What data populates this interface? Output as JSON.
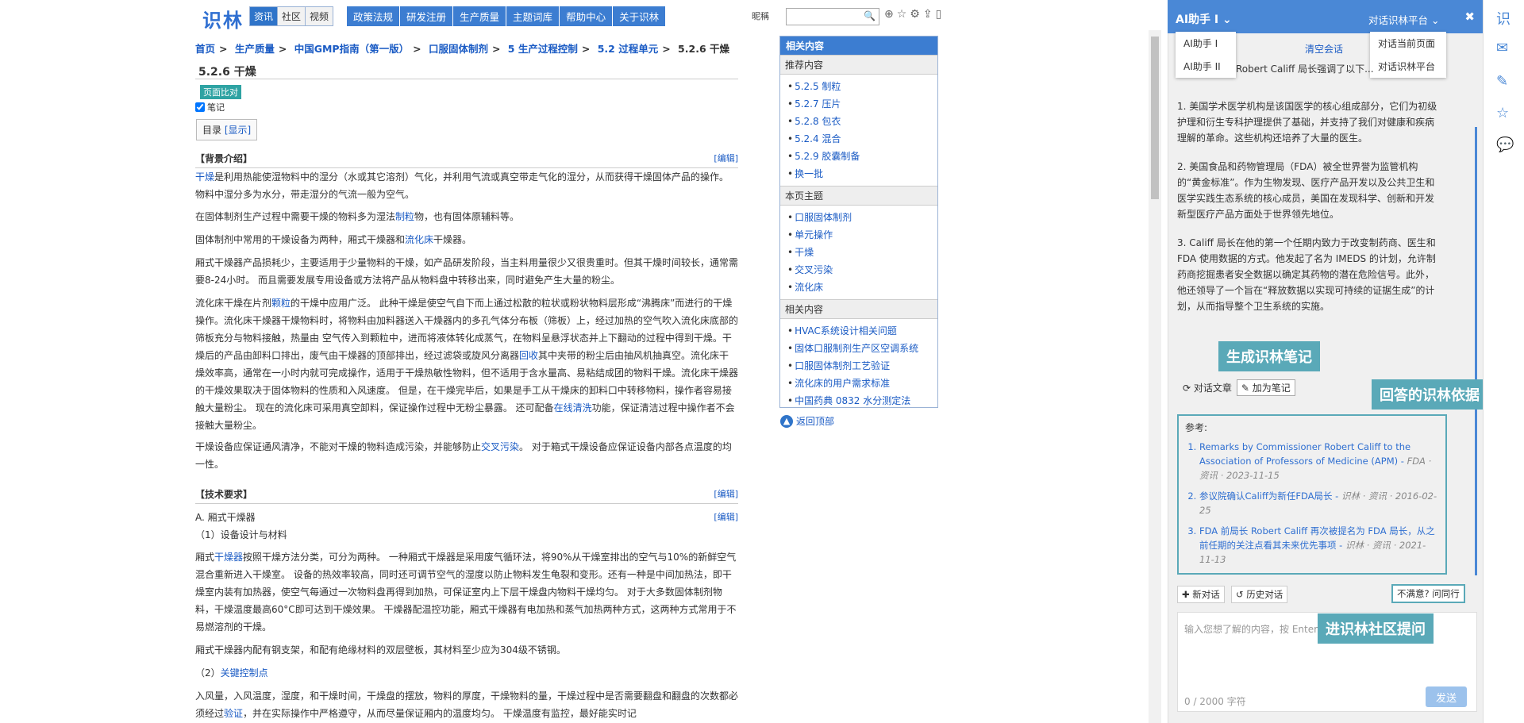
{
  "site": {
    "logo": "识林",
    "tabs": [
      {
        "label": "资讯",
        "active": true
      },
      {
        "label": "社区",
        "active": false
      },
      {
        "label": "视频",
        "active": false
      }
    ],
    "menu": [
      "政策法规",
      "研发注册",
      "生产质量",
      "主题词库",
      "帮助中心",
      "关于识林"
    ],
    "search_label": "昵稱",
    "search_placeholder": ""
  },
  "breadcrumb": [
    "首页",
    "生产质量",
    "中国GMP指南（第一版）",
    "口服固体制剂",
    "5 生产过程控制",
    "5.2 过程单元",
    "5.2.6 干燥"
  ],
  "page": {
    "title": "5.2.6 干燥",
    "compare_label": "页面比对",
    "note_label": "笔记",
    "toc_label": "目录",
    "toc_show": "[显示]",
    "edit_label": "[编辑]"
  },
  "sections": {
    "background": "【背景介绍】",
    "tech": "【技术要求】",
    "sub_a": "A. 厢式干燥器",
    "sub_a1": "（1）设备设计与材料",
    "sub_a2_num": "（2）",
    "sub_a2_link": "关键控制点"
  },
  "paragraphs": {
    "p1_link": "干燥",
    "p1": "是利用热能使湿物料中的湿分（水或其它溶剂）气化，并利用气流或真空带走气化的湿分，从而获得干燥固体产品的操作。物料中湿分多为水分，带走湿分的气流一般为空气。",
    "p2a": "在固体制剂生产过程中需要干燥的物料多为湿法",
    "p2_link": "制粒",
    "p2b": "物，也有固体原辅料等。",
    "p3a": "固体制剂中常用的干燥设备为两种，厢式干燥器和",
    "p3_link": "流化床",
    "p3b": "干燥器。",
    "p4": "厢式干燥器产品损耗少，主要适用于少量物料的干燥，如产品研发阶段，当主料用量很少又很贵重时。但其干燥时间较长，通常需要8-24小时。 而且需要发展专用设备或方法将产品从物料盘中转移出来，同时避免产生大量的粉尘。",
    "p5a": "流化床干燥在片剂",
    "p5_link1": "颗粒",
    "p5b": "的干燥中应用广泛。 此种干燥是使空气自下而上通过松散的粒状或粉状物料层形成“沸腾床”而进行的干燥操作。流化床干燥器干燥物料时，将物料由加料器送入干燥器内的多孔气体分布板（筛板）上，经过加热的空气吹入流化床底部的筛板充分与物料接触，热量由 空气传入到颗粒中，进而将液体转化成蒸气，在物料呈悬浮状态并上下翻动的过程中得到干燥。干燥后的产品由卸料口排出，废气由干燥器的顶部排出，经过滤袋或旋风分离器",
    "p5_link2": "回收",
    "p5c": "其中夹带的粉尘后由抽风机抽真空。流化床干燥效率高，通常在一小时内就可完成操作，适用于干燥热敏性物料，但不适用于含水量高、易粘结成团的物料干燥。流化床干燥器的干燥效果取决于固体物料的性质和入风速度。 但是，在干燥完毕后，如果是手工从干燥床的卸料口中转移物料，操作者容易接触大量粉尘。 现在的流化床可采用真空卸料，保证操作过程中无粉尘暴露。 还可配备",
    "p5_link3": "在线清洗",
    "p5d": "功能，保证清洁过程中操作者不会接触大量粉尘。",
    "p6a": "干燥设备应保证通风清净，不能对干燥的物料造成污染，并能够防止",
    "p6_link": "交叉污染",
    "p6b": "。 对于箱式干燥设备应保证设备内部各点温度的均一性。",
    "p7a": "厢式",
    "p7_link": "干燥器",
    "p7b": "按照干燥方法分类，可分为两种。 一种厢式干燥器是采用废气循环法，将90%从干燥室排出的空气与10%的新鲜空气混合重新进入干燥室。 设备的热效率较高，同时还可调节空气的湿度以防止物料发生龟裂和变形。还有一种是中间加热法，即干燥室内装有加热器，使空气每通过一次物料盘再得到加热，可保证室内上下层干燥盘内物料干燥均匀。 对于大多数固体制剂物料，干燥温度最高60°C即可达到干燥效果。 干燥器配温控功能，厢式干燥器有电加热和蒸气加热两种方式，这两种方式常用于不易燃溶剂的干燥。",
    "p8": "厢式干燥器内配有钢支架，和配有绝缘材料的双层壁板，其材料至少应为304级不锈钢。",
    "p9a": "入风量，入风温度，湿度，和干燥时间，干燥盘的摆放，物料的厚度，干燥物料的量，干燥过程中是否需要翻盘和翻盘的次数都必须经过",
    "p9_link": "验证",
    "p9b": "，并在实际操作中严格遵守，从而尽量保证厢内的温度均匀。 干燥温度有监控，最好能实时记"
  },
  "related": {
    "header": "相关内容",
    "recommended_title": "推荐内容",
    "recommended": [
      "5.2.5 制粒",
      "5.2.7 压片",
      "5.2.8 包衣",
      "5.2.4 混合",
      "5.2.9 胶囊制备",
      "换一批"
    ],
    "topics_title": "本页主题",
    "topics": [
      "口服固体制剂",
      "单元操作",
      "干燥",
      "交叉污染",
      "流化床"
    ],
    "related_title": "相关内容",
    "related_items": [
      "HVAC系统设计相关问题",
      "固体口服制剂生产区空调系统",
      "口服固体制剂工艺验证",
      "流化床的用户需求标准",
      "中国药典 0832 水分测定法"
    ],
    "back_to_top": "返回顶部"
  },
  "ai": {
    "title": "AI助手 I",
    "scope": "对话识林平台",
    "close": "✖",
    "assistants": [
      "AI助手 I",
      "AI助手 II"
    ],
    "scope_options": [
      "对话当前页面",
      "对话识林平台"
    ],
    "clear": "清空会话",
    "partial_question": "Robert Califf 局长强调了以下...",
    "answer": [
      "1. 美国学术医学机构是该国医学的核心组成部分，它们为初级护理和衍生专科护理提供了基础，并支持了我们对健康和疾病理解的革命。这些机构还培养了大量的医生。",
      "2. 美国食品和药物管理局（FDA）被全世界誉为监管机构的“黄金标准”。作为生物发现、医疗产品开发以及公共卫生和医学实践生态系统的核心成员，美国在发现科学、创新和开发新型医疗产品方面处于世界领先地位。",
      "3. Califf 局长在他的第一个任期内致力于改变制药商、医生和 FDA 使用数据的方式。他发起了名为 IMEDS 的计划，允许制药商挖掘患者安全数据以确定其药物的潜在危险信号。此外，他还领导了一个旨在“释放数据以实现可持续的证据生成”的计划，从而指导整个卫生系统的实施。"
    ],
    "regen": "对话文章",
    "add_note": "加为笔记",
    "refs_label": "参考:",
    "refs": [
      {
        "title": "Remarks by Commissioner Robert Califf to the Association of Professors of Medicine (APM)",
        "meta": "FDA · 资讯 · 2023-11-15"
      },
      {
        "title": "参议院确认Califf为新任FDA局长",
        "meta": "识林 · 资讯 · 2016-02-25"
      },
      {
        "title": "FDA 前局长 Robert Califf 再次被提名为 FDA 局长，从之前任期的关注点看其未来优先事项",
        "meta": "识林 · 资讯 · 2021-11-13"
      }
    ],
    "new_chat": "新对话",
    "history": "历史对话",
    "ask_peer": "不满意? 问同行",
    "input_placeholder": "输入您想了解的内容，按 Enter",
    "char_count": "0 / 2000 字符",
    "send": "发送"
  },
  "callouts": {
    "note": "生成识林笔记",
    "refs": "回答的识林依据",
    "community": "进识林社区提问"
  },
  "rail": [
    "识",
    "✉",
    "✎",
    "☆",
    "💬"
  ]
}
